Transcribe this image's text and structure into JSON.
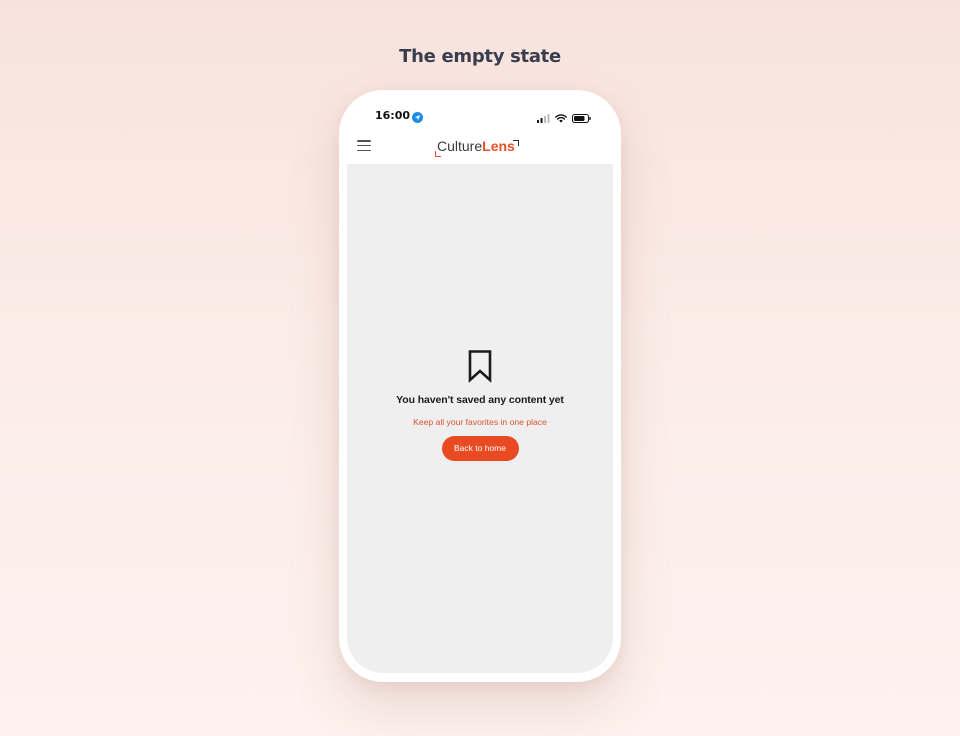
{
  "page": {
    "heading": "The empty state"
  },
  "status_bar": {
    "time": "16:00",
    "icons": [
      "location-arrow-icon",
      "cellular-signal-icon",
      "wifi-icon",
      "battery-icon"
    ]
  },
  "navbar": {
    "menu_icon": "hamburger-menu-icon",
    "logo": {
      "part1": "Culture",
      "part2": "Lens"
    }
  },
  "empty_state": {
    "icon": "bookmark-icon",
    "title": "You haven't saved any content yet",
    "subtitle": "Keep all your favorites in one place",
    "button_label": "Back to home"
  },
  "colors": {
    "accent": "#e84a22",
    "background": "#f8e3dc",
    "content_bg": "#efefef",
    "heading": "#3a3d4e"
  }
}
